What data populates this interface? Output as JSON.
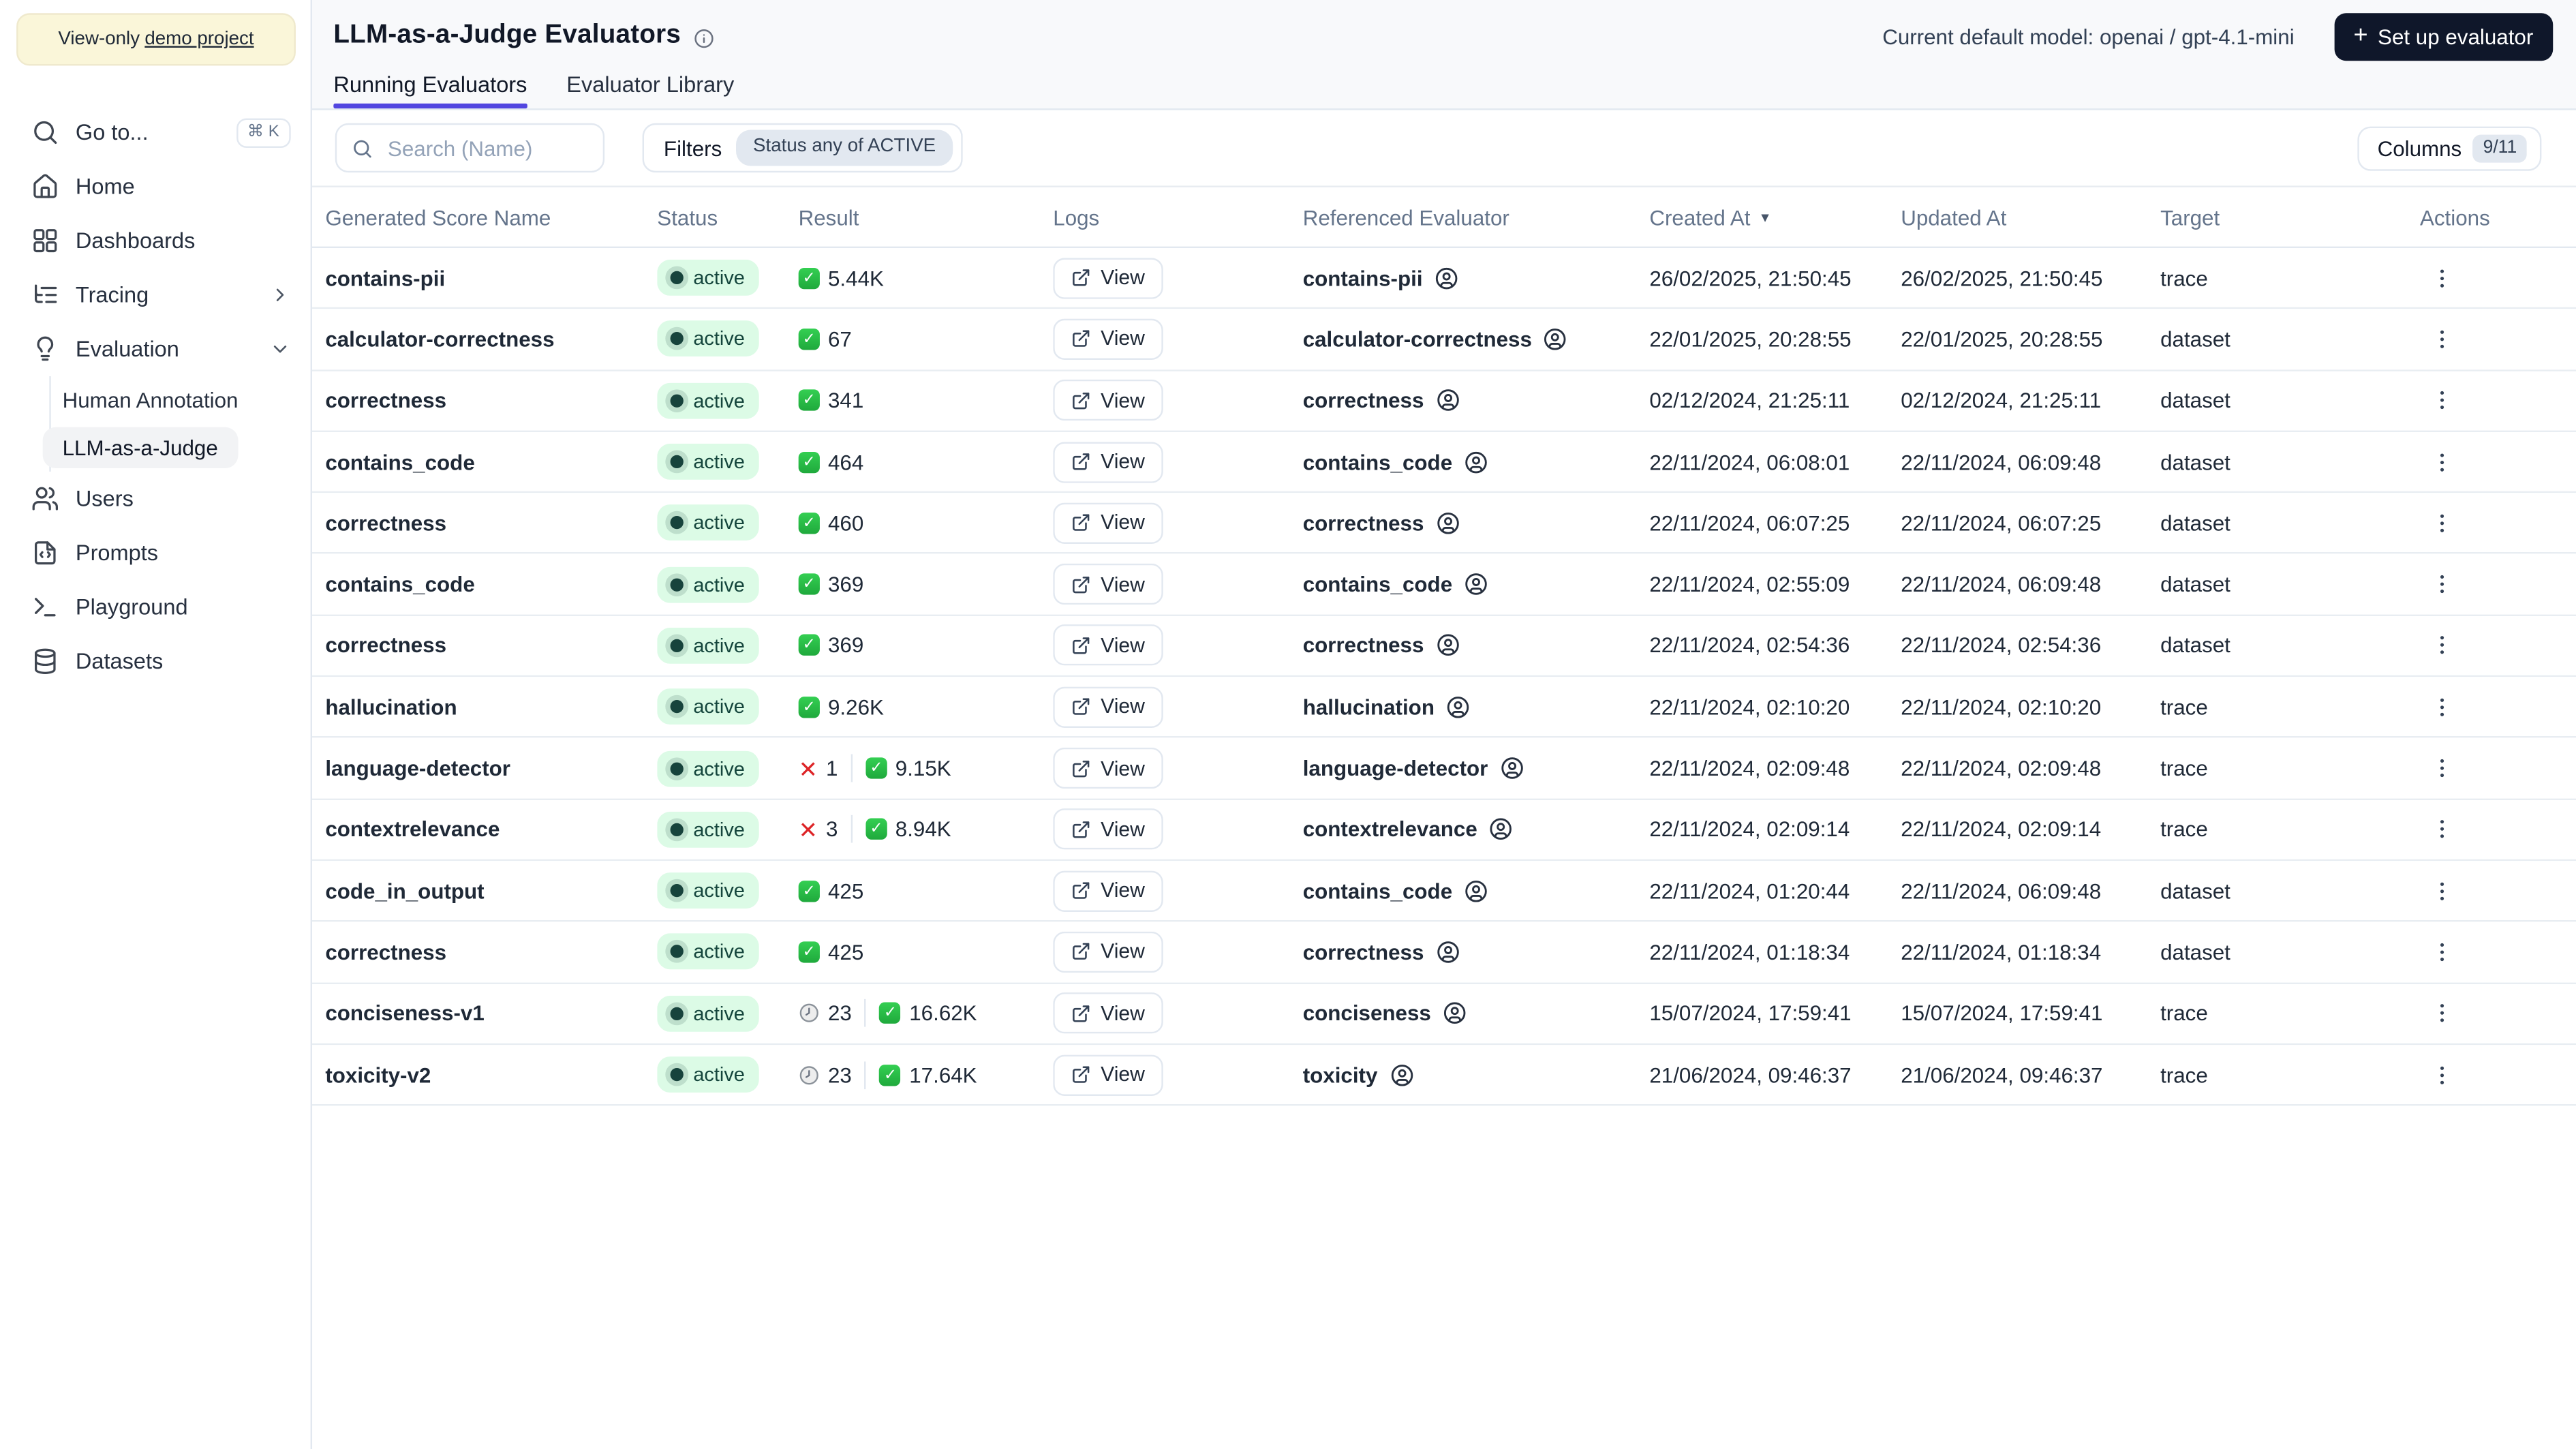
{
  "banner": {
    "prefix": "View-only",
    "link_label": "demo project"
  },
  "sidebar": {
    "items": [
      {
        "label": "Go to...",
        "shortcut": "⌘ K"
      },
      {
        "label": "Home"
      },
      {
        "label": "Dashboards"
      },
      {
        "label": "Tracing"
      },
      {
        "label": "Evaluation"
      },
      {
        "label": "Human Annotation"
      },
      {
        "label": "LLM-as-a-Judge"
      },
      {
        "label": "Users"
      },
      {
        "label": "Prompts"
      },
      {
        "label": "Playground"
      },
      {
        "label": "Datasets"
      }
    ]
  },
  "header": {
    "title": "LLM-as-a-Judge Evaluators",
    "model_label": "Current default model: openai / gpt-4.1-mini",
    "setup_plus": "+",
    "setup_label": "Set up evaluator"
  },
  "tabs": [
    {
      "label": "Running Evaluators",
      "active": true
    },
    {
      "label": "Evaluator Library",
      "active": false
    }
  ],
  "toolbar": {
    "search_placeholder": "Search (Name)",
    "filters_label": "Filters",
    "filter_chip": "Status any of ACTIVE",
    "columns_label": "Columns",
    "columns_count": "9/11"
  },
  "colors": {
    "accent_indigo": "#5246e0",
    "active_badge_bg": "#dcfbe6",
    "active_badge_text": "#14453c",
    "success_green": "#22b843",
    "error_red": "#dd2427",
    "dark_button": "#0f172a",
    "banner_yellow": "#faf6d9"
  },
  "table": {
    "columns": [
      "Generated Score Name",
      "Status",
      "Result",
      "Logs",
      "Referenced Evaluator",
      "Created At",
      "Updated At",
      "Target",
      "Actions"
    ],
    "sort_indicator": "▼",
    "sorted_column": "Created At",
    "status_label": "active",
    "logs_label": "View",
    "rows": [
      {
        "name": "contains-pii",
        "status": "active",
        "result": [
          {
            "kind": "success",
            "value": "5.44K"
          }
        ],
        "evaluator": "contains-pii",
        "created_at": "26/02/2025, 21:50:45",
        "updated_at": "26/02/2025, 21:50:45",
        "target": "trace"
      },
      {
        "name": "calculator-correctness",
        "status": "active",
        "result": [
          {
            "kind": "success",
            "value": "67"
          }
        ],
        "evaluator": "calculator-correctness",
        "created_at": "22/01/2025, 20:28:55",
        "updated_at": "22/01/2025, 20:28:55",
        "target": "dataset"
      },
      {
        "name": "correctness",
        "status": "active",
        "result": [
          {
            "kind": "success",
            "value": "341"
          }
        ],
        "evaluator": "correctness",
        "created_at": "02/12/2024, 21:25:11",
        "updated_at": "02/12/2024, 21:25:11",
        "target": "dataset"
      },
      {
        "name": "contains_code",
        "status": "active",
        "result": [
          {
            "kind": "success",
            "value": "464"
          }
        ],
        "evaluator": "contains_code",
        "created_at": "22/11/2024, 06:08:01",
        "updated_at": "22/11/2024, 06:09:48",
        "target": "dataset"
      },
      {
        "name": "correctness",
        "status": "active",
        "result": [
          {
            "kind": "success",
            "value": "460"
          }
        ],
        "evaluator": "correctness",
        "created_at": "22/11/2024, 06:07:25",
        "updated_at": "22/11/2024, 06:07:25",
        "target": "dataset"
      },
      {
        "name": "contains_code",
        "status": "active",
        "result": [
          {
            "kind": "success",
            "value": "369"
          }
        ],
        "evaluator": "contains_code",
        "created_at": "22/11/2024, 02:55:09",
        "updated_at": "22/11/2024, 06:09:48",
        "target": "dataset"
      },
      {
        "name": "correctness",
        "status": "active",
        "result": [
          {
            "kind": "success",
            "value": "369"
          }
        ],
        "evaluator": "correctness",
        "created_at": "22/11/2024, 02:54:36",
        "updated_at": "22/11/2024, 02:54:36",
        "target": "dataset"
      },
      {
        "name": "hallucination",
        "status": "active",
        "result": [
          {
            "kind": "success",
            "value": "9.26K"
          }
        ],
        "evaluator": "hallucination",
        "created_at": "22/11/2024, 02:10:20",
        "updated_at": "22/11/2024, 02:10:20",
        "target": "trace"
      },
      {
        "name": "language-detector",
        "status": "active",
        "result": [
          {
            "kind": "error",
            "value": "1"
          },
          {
            "kind": "success",
            "value": "9.15K"
          }
        ],
        "evaluator": "language-detector",
        "created_at": "22/11/2024, 02:09:48",
        "updated_at": "22/11/2024, 02:09:48",
        "target": "trace"
      },
      {
        "name": "contextrelevance",
        "status": "active",
        "result": [
          {
            "kind": "error",
            "value": "3"
          },
          {
            "kind": "success",
            "value": "8.94K"
          }
        ],
        "evaluator": "contextrelevance",
        "created_at": "22/11/2024, 02:09:14",
        "updated_at": "22/11/2024, 02:09:14",
        "target": "trace"
      },
      {
        "name": "code_in_output",
        "status": "active",
        "result": [
          {
            "kind": "success",
            "value": "425"
          }
        ],
        "evaluator": "contains_code",
        "created_at": "22/11/2024, 01:20:44",
        "updated_at": "22/11/2024, 06:09:48",
        "target": "dataset"
      },
      {
        "name": "correctness",
        "status": "active",
        "result": [
          {
            "kind": "success",
            "value": "425"
          }
        ],
        "evaluator": "correctness",
        "created_at": "22/11/2024, 01:18:34",
        "updated_at": "22/11/2024, 01:18:34",
        "target": "dataset"
      },
      {
        "name": "conciseness-v1",
        "status": "active",
        "result": [
          {
            "kind": "pending",
            "value": "23"
          },
          {
            "kind": "success",
            "value": "16.62K"
          }
        ],
        "evaluator": "conciseness",
        "created_at": "15/07/2024, 17:59:41",
        "updated_at": "15/07/2024, 17:59:41",
        "target": "trace"
      },
      {
        "name": "toxicity-v2",
        "status": "active",
        "result": [
          {
            "kind": "pending",
            "value": "23"
          },
          {
            "kind": "success",
            "value": "17.64K"
          }
        ],
        "evaluator": "toxicity",
        "created_at": "21/06/2024, 09:46:37",
        "updated_at": "21/06/2024, 09:46:37",
        "target": "trace"
      }
    ]
  }
}
